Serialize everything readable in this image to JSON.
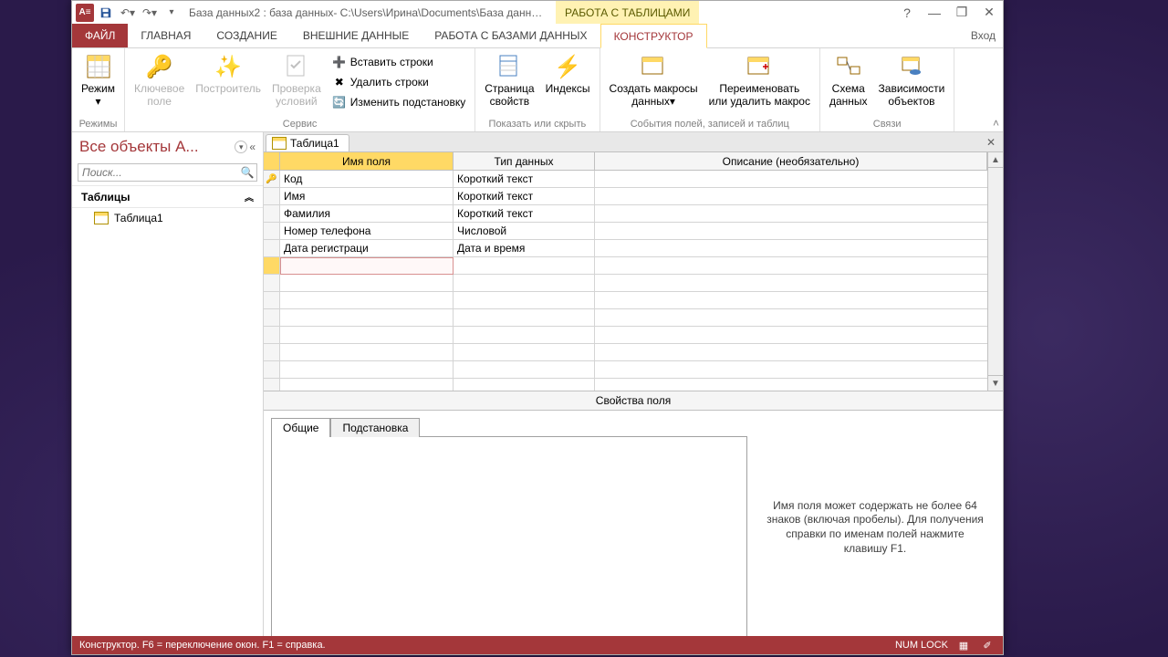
{
  "titlebar": {
    "title": "База данных2 : база данных- C:\\Users\\Ирина\\Documents\\База данных...",
    "context_title": "РАБОТА С ТАБЛИЦАМИ"
  },
  "menu": {
    "file": "ФАЙЛ",
    "tabs": [
      "ГЛАВНАЯ",
      "СОЗДАНИЕ",
      "ВНЕШНИЕ ДАННЫЕ",
      "РАБОТА С БАЗАМИ ДАННЫХ"
    ],
    "context_tab": "КОНСТРУКТОР",
    "login": "Вход"
  },
  "ribbon": {
    "groups": {
      "modes": {
        "label": "Режимы",
        "view": "Режим"
      },
      "service": {
        "label": "Сервис",
        "key": "Ключевое\nполе",
        "builder": "Построитель",
        "validate": "Проверка\nусловий",
        "insert_rows": "Вставить строки",
        "delete_rows": "Удалить строки",
        "change_lookup": "Изменить подстановку"
      },
      "showhide": {
        "label": "Показать или скрыть",
        "props_page": "Страница\nсвойств",
        "indexes": "Индексы"
      },
      "events": {
        "label": "События полей, записей и таблиц",
        "create_macros": "Создать макросы\nданных▾",
        "rename_macro": "Переименовать\nили удалить макрос"
      },
      "relations": {
        "label": "Связи",
        "schema": "Схема\nданных",
        "deps": "Зависимости\nобъектов"
      }
    }
  },
  "nav": {
    "title": "Все объекты A...",
    "search_placeholder": "Поиск...",
    "group_tables": "Таблицы",
    "items": [
      "Таблица1"
    ]
  },
  "doc": {
    "tab_name": "Таблица1",
    "headers": {
      "name": "Имя поля",
      "type": "Тип данных",
      "desc": "Описание (необязательно)"
    },
    "fields": [
      {
        "name": "Код",
        "type": "Короткий текст",
        "pk": true
      },
      {
        "name": "Имя",
        "type": "Короткий текст"
      },
      {
        "name": "Фамилия",
        "type": "Короткий текст"
      },
      {
        "name": "Номер телефона",
        "type": "Числовой"
      },
      {
        "name": "Дата регистраци",
        "type": "Дата и время"
      }
    ],
    "props_title": "Свойства поля",
    "props_tabs": {
      "general": "Общие",
      "lookup": "Подстановка"
    },
    "help_text": "Имя поля может содержать не более 64 знаков (включая пробелы). Для получения справки по именам полей нажмите клавишу F1."
  },
  "status": {
    "left": "Конструктор.  F6 = переключение окон.  F1 = справка.",
    "numlock": "NUM LOCK"
  }
}
